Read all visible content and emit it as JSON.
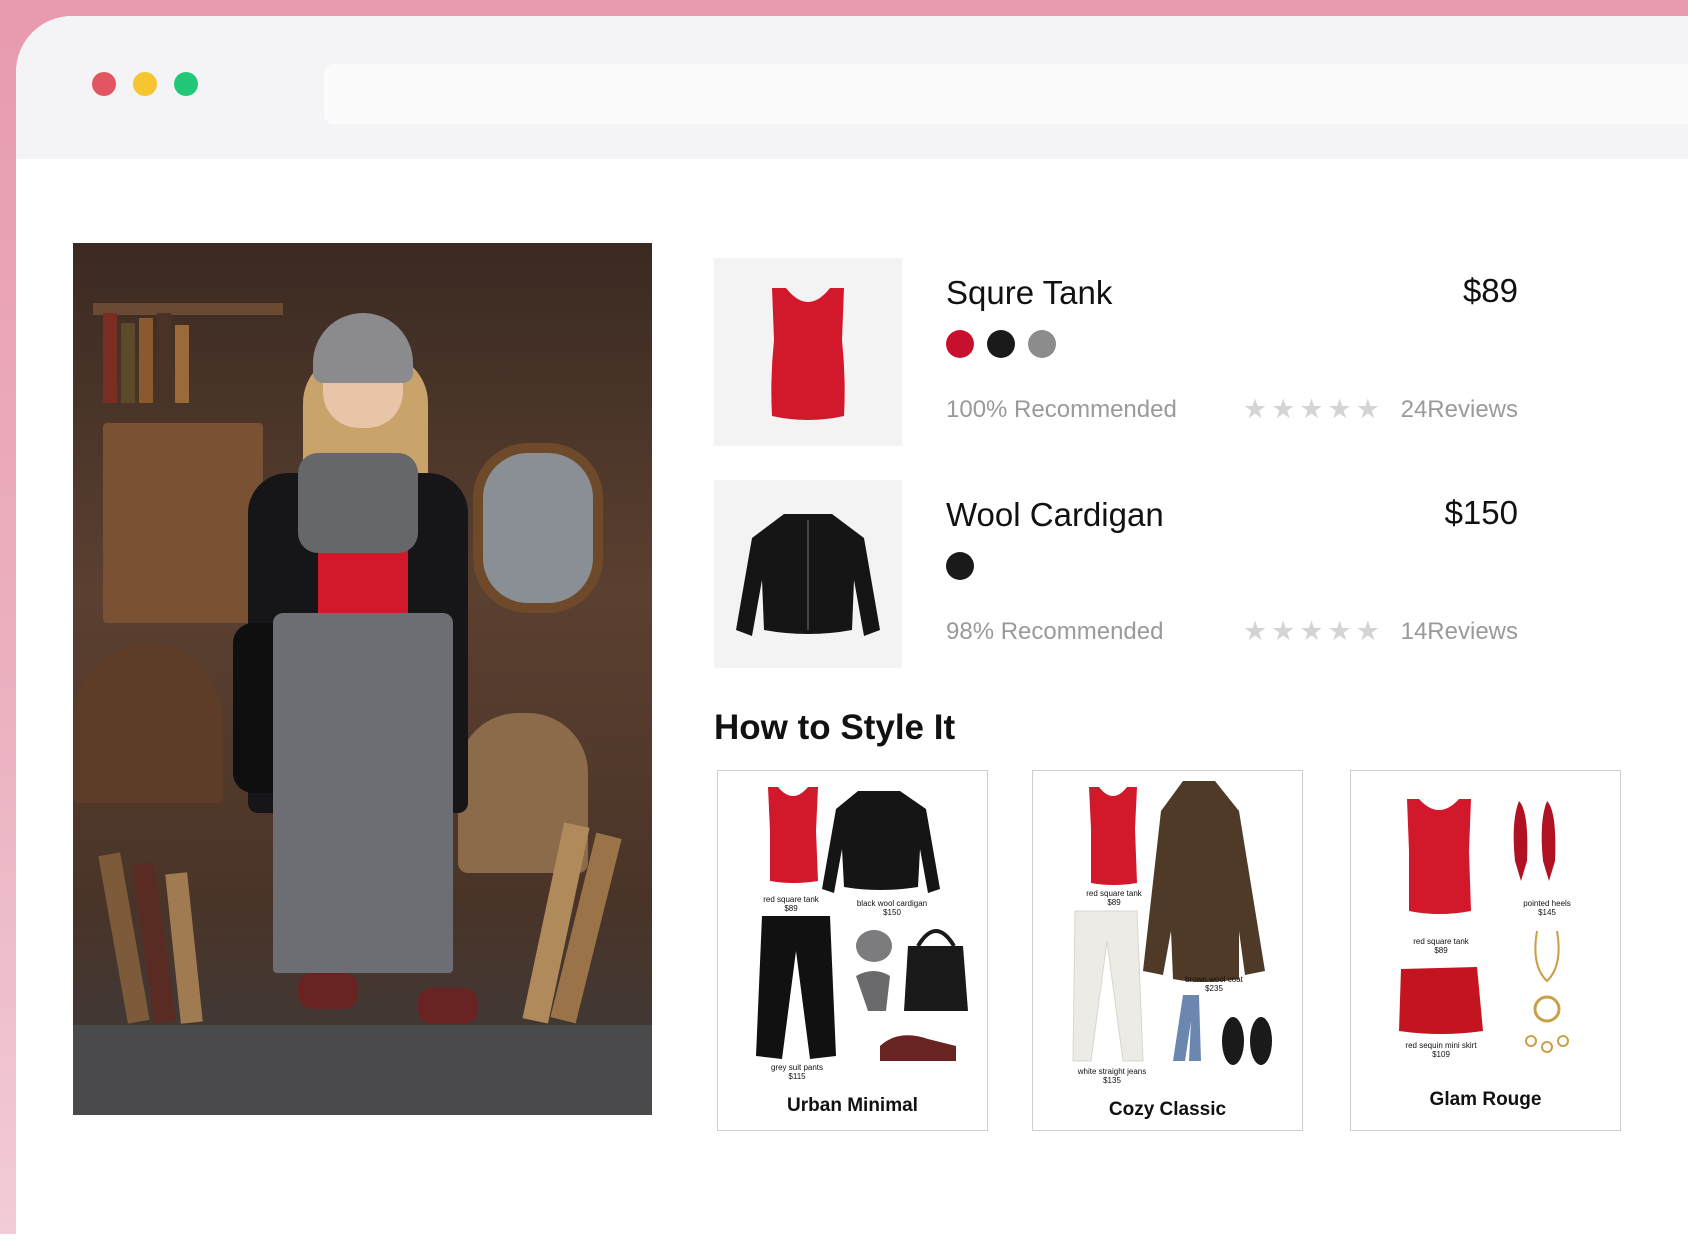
{
  "window": {
    "controls": [
      "close",
      "minimize",
      "maximize"
    ],
    "accent_colors": {
      "close": "#e25563",
      "minimize": "#f6c530",
      "maximize": "#22c777"
    }
  },
  "products": [
    {
      "name": "Squre Tank",
      "price": "$89",
      "colors": [
        "#c8102e",
        "#1a1a1a",
        "#8c8c8c"
      ],
      "recommended": "100% Recommended",
      "stars": "★★★★★",
      "reviews": "24Reviews"
    },
    {
      "name": "Wool Cardigan",
      "price": "$150",
      "colors": [
        "#1a1a1a"
      ],
      "recommended": "98% Recommended",
      "stars": "★★★★★",
      "reviews": "14Reviews"
    }
  ],
  "style_section": {
    "title": "How to Style It",
    "looks": [
      {
        "name": "Urban Minimal",
        "items": [
          {
            "label": "red square tank",
            "price": "$89"
          },
          {
            "label": "black wool cardigan",
            "price": "$150"
          },
          {
            "label": "grey suit pants",
            "price": "$115"
          }
        ]
      },
      {
        "name": "Cozy Classic",
        "items": [
          {
            "label": "red square tank",
            "price": "$89"
          },
          {
            "label": "brown wool coat",
            "price": "$235"
          },
          {
            "label": "white straight jeans",
            "price": "$135"
          }
        ]
      },
      {
        "name": "Glam Rouge",
        "items": [
          {
            "label": "pointed heels",
            "price": "$145"
          },
          {
            "label": "red square tank",
            "price": "$89"
          },
          {
            "label": "red sequin mini skirt",
            "price": "$109"
          }
        ]
      }
    ]
  }
}
